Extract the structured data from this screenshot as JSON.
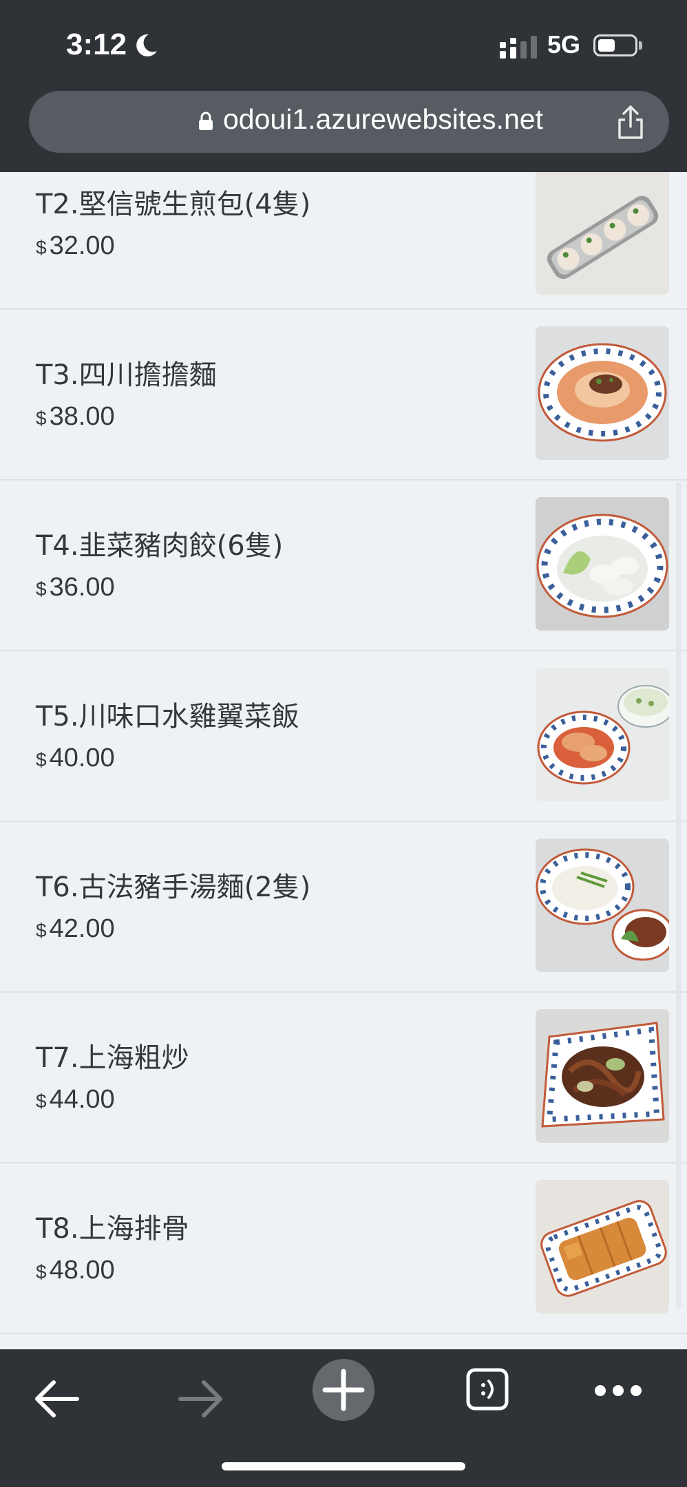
{
  "status_bar": {
    "time": "3:12",
    "network": "5G"
  },
  "browser": {
    "url": "odoui1.azurewebsites.net"
  },
  "menu": {
    "currency_symbol": "$",
    "items": [
      {
        "name": "T2.堅信號生煎包(4隻)",
        "price": "32.00",
        "image": "pan-fried-buns-photo"
      },
      {
        "name": "T3.四川擔擔麵",
        "price": "38.00",
        "image": "dan-dan-noodles-photo"
      },
      {
        "name": "T4.韭菜豬肉餃(6隻)",
        "price": "36.00",
        "image": "dumplings-photo"
      },
      {
        "name": "T5.川味口水雞翼菜飯",
        "price": "40.00",
        "image": "chicken-wings-rice-photo"
      },
      {
        "name": "T6.古法豬手湯麵(2隻)",
        "price": "42.00",
        "image": "pork-knuckle-noodle-photo"
      },
      {
        "name": "T7.上海粗炒",
        "price": "44.00",
        "image": "fried-noodles-photo"
      },
      {
        "name": "T8.上海排骨",
        "price": "48.00",
        "image": "pork-chop-photo"
      }
    ]
  },
  "toolbar": {
    "buttons": [
      "back-arrow-icon",
      "forward-arrow-icon",
      "new-tab-plus-icon",
      "tab-switcher-icon",
      "more-menu-icon"
    ]
  },
  "colors": {
    "chrome": "#2f3338",
    "page_bg": "#eff2f5",
    "text": "#33383d"
  }
}
